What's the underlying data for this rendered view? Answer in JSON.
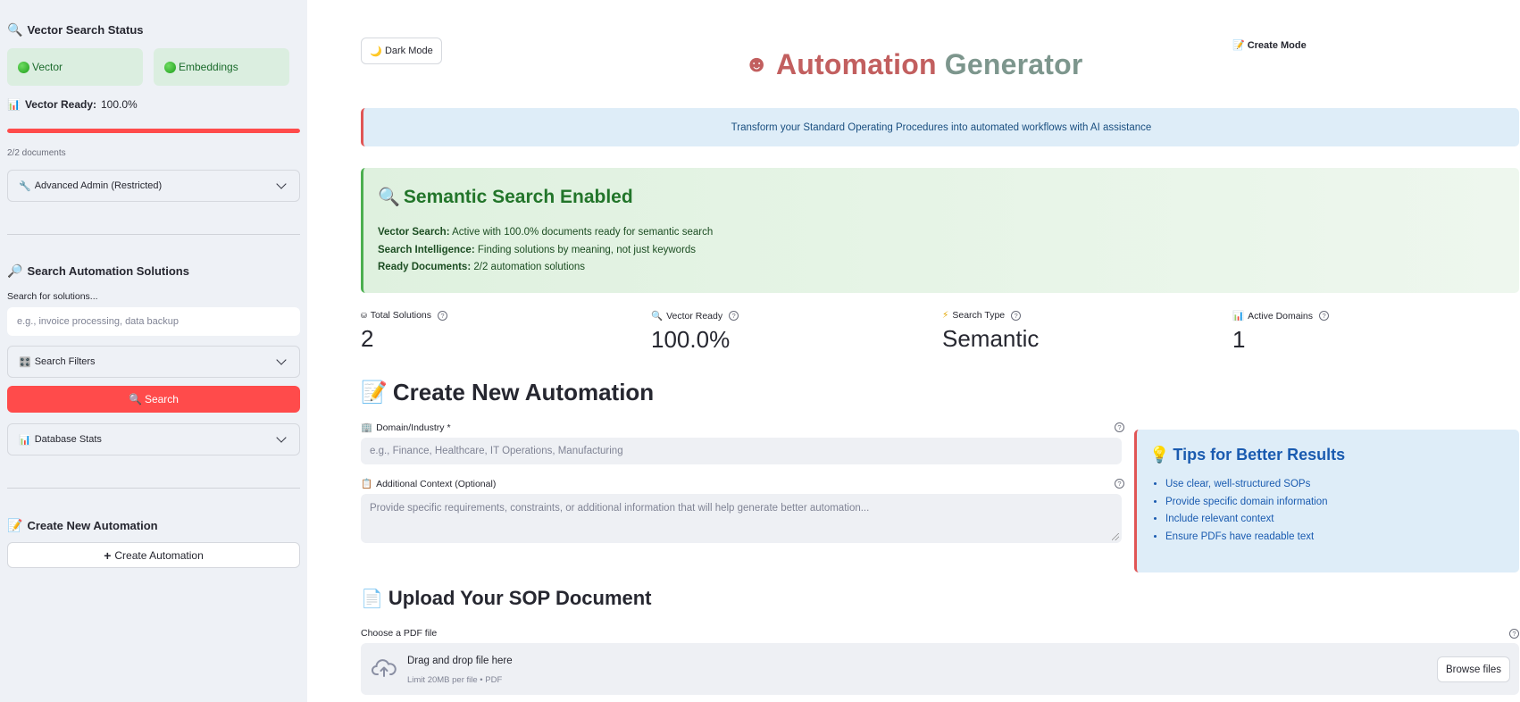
{
  "sidebar": {
    "status_title": "Vector Search Status",
    "status_boxes": [
      "Vector",
      "Embeddings"
    ],
    "vector_ready_label": "Vector Ready:",
    "vector_ready_value": "100.0%",
    "progress": 1.0,
    "docs_count": "2/2 documents",
    "admin_expander": "Advanced Admin (Restricted)",
    "search_title": "Search Automation Solutions",
    "search_label": "Search for solutions...",
    "search_placeholder": "e.g., invoice processing, data backup",
    "filters_expander": "Search Filters",
    "search_button": "Search",
    "db_stats_expander": "Database Stats",
    "create_title": "Create New Automation",
    "create_button": "Create Automation"
  },
  "main": {
    "dark_mode_button": "Dark Mode",
    "create_mode_label": "Create Mode",
    "title_part1": "Automation",
    "title_part2": "Generator",
    "info_banner": "Transform your Standard Operating Procedures into automated workflows with AI assistance",
    "semantic": {
      "heading": "Semantic Search Enabled",
      "lines": [
        {
          "label": "Vector Search:",
          "text": "Active with 100.0% documents ready for semantic search"
        },
        {
          "label": "Search Intelligence:",
          "text": "Finding solutions by meaning, not just keywords"
        },
        {
          "label": "Ready Documents:",
          "text": "2/2 automation solutions"
        }
      ]
    },
    "metrics": [
      {
        "label": "Total Solutions",
        "value": "2",
        "icon": "database-icon"
      },
      {
        "label": "Vector Ready",
        "value": "100.0%",
        "icon": "magnifier-icon"
      },
      {
        "label": "Search Type",
        "value": "Semantic",
        "icon": "lightning-icon"
      },
      {
        "label": "Active Domains",
        "value": "1",
        "icon": "bar-chart-icon"
      }
    ],
    "create_heading": "Create New Automation",
    "domain_label": "Domain/Industry *",
    "domain_placeholder": "e.g., Finance, Healthcare, IT Operations, Manufacturing",
    "context_label": "Additional Context (Optional)",
    "context_placeholder": "Provide specific requirements, constraints, or additional information that will help generate better automation...",
    "tips": {
      "heading": "Tips for Better Results",
      "items": [
        "Use clear, well-structured SOPs",
        "Provide specific domain information",
        "Include relevant context",
        "Ensure PDFs have readable text"
      ]
    },
    "upload_heading": "Upload Your SOP Document",
    "file_label": "Choose a PDF file",
    "dropzone_title": "Drag and drop file here",
    "dropzone_sub": "Limit 20MB per file • PDF",
    "browse_button": "Browse files"
  },
  "colors": {
    "accent_red": "#ff4b4b",
    "title_red": "#c25f5f",
    "title_green": "#7d968d",
    "success_green": "#22752a",
    "info_blue": "#1a5bb0"
  }
}
